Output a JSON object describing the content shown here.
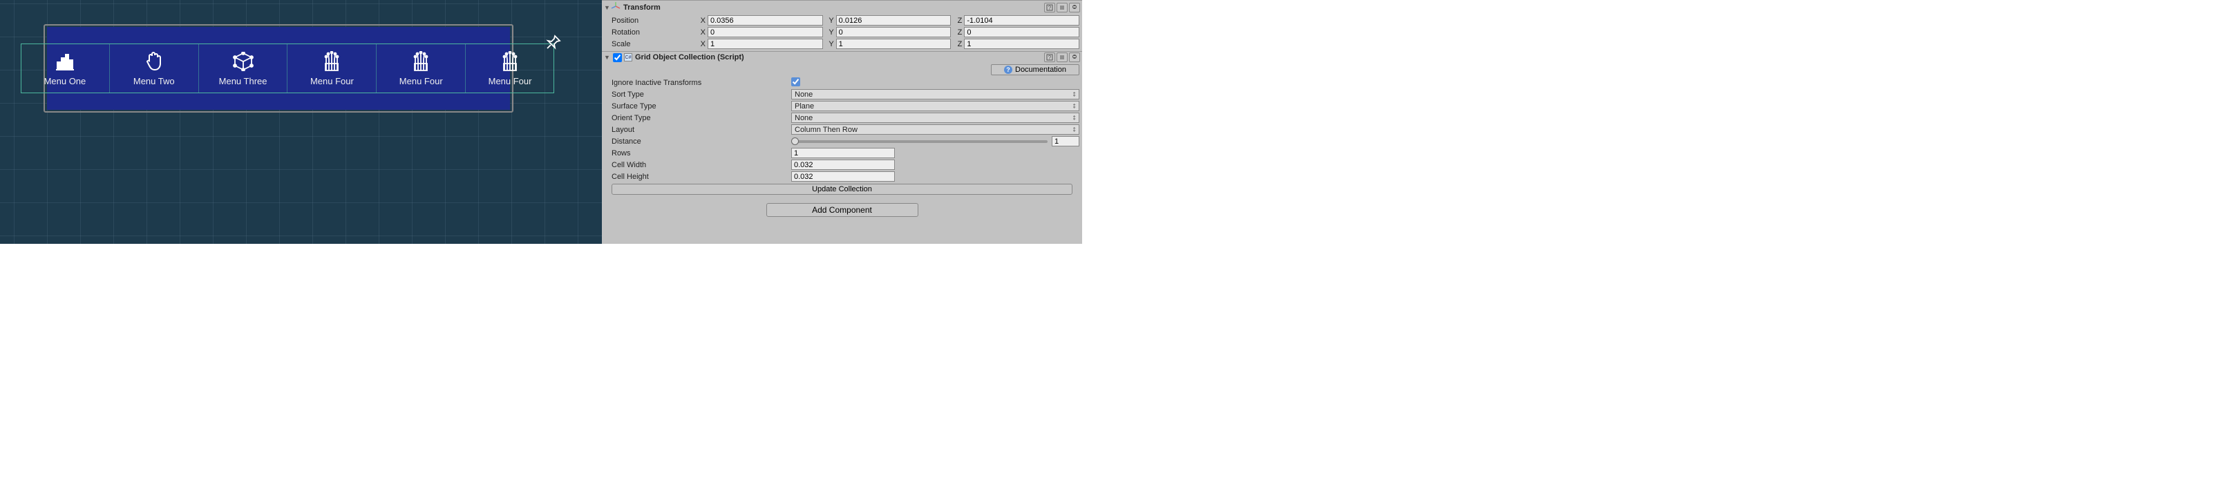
{
  "scene": {
    "menu_items": [
      {
        "label": "Menu One"
      },
      {
        "label": "Menu Two"
      },
      {
        "label": "Menu Three"
      },
      {
        "label": "Menu Four"
      },
      {
        "label": "Menu Four"
      },
      {
        "label": "Menu Four"
      }
    ]
  },
  "inspector": {
    "transform": {
      "title": "Transform",
      "position_label": "Position",
      "rotation_label": "Rotation",
      "scale_label": "Scale",
      "position": {
        "x": "0.0356",
        "y": "0.0126",
        "z": "-1.0104"
      },
      "rotation": {
        "x": "0",
        "y": "0",
        "z": "0"
      },
      "scale": {
        "x": "1",
        "y": "1",
        "z": "1"
      },
      "axis_x": "X",
      "axis_y": "Y",
      "axis_z": "Z"
    },
    "grid_collection": {
      "title": "Grid Object Collection (Script)",
      "documentation_label": "Documentation",
      "ignore_inactive_label": "Ignore Inactive Transforms",
      "ignore_inactive": true,
      "sort_type_label": "Sort Type",
      "sort_type": "None",
      "surface_type_label": "Surface Type",
      "surface_type": "Plane",
      "orient_type_label": "Orient Type",
      "orient_type": "None",
      "layout_label": "Layout",
      "layout": "Column Then Row",
      "distance_label": "Distance",
      "distance": "1",
      "rows_label": "Rows",
      "rows": "1",
      "cell_width_label": "Cell Width",
      "cell_width": "0.032",
      "cell_height_label": "Cell Height",
      "cell_height": "0.032",
      "update_label": "Update Collection"
    },
    "add_component_label": "Add Component"
  }
}
